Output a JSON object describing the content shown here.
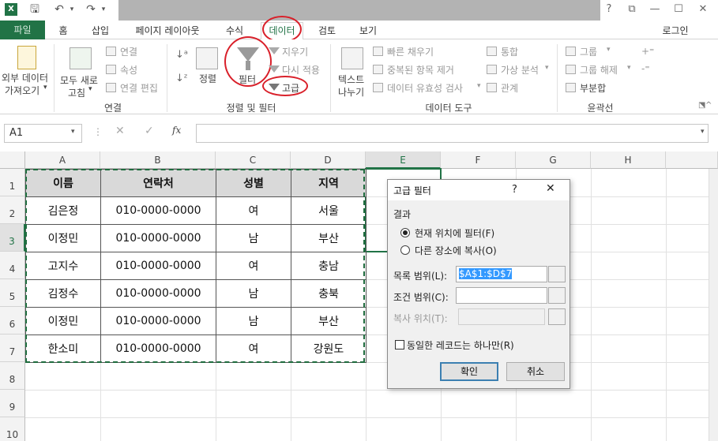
{
  "quick_access": {
    "excel": "X"
  },
  "window_controls": {
    "help": "?",
    "restore_ribbon": "⧉",
    "minimize": "—",
    "maximize": "☐",
    "close": "✕"
  },
  "tabs": [
    "파일",
    "홈",
    "삽입",
    "페이지 레이아웃",
    "수식",
    "데이터",
    "검토",
    "보기"
  ],
  "login": "로그인",
  "ribbon": {
    "external_data": [
      "외부 데이터",
      "가져오기"
    ],
    "refresh_all": [
      "모두 새로",
      "고침"
    ],
    "connections": "연결",
    "properties": "속성",
    "edit_links": "연결 편집",
    "group_connections": "연결",
    "sort": "정렬",
    "filter": "필터",
    "clear": "지우기",
    "reapply": "다시 적용",
    "advanced": "고급",
    "group_sort_filter": "정렬 및 필터",
    "text_to_columns": [
      "텍스트",
      "나누기"
    ],
    "flash_fill": "빠른 채우기",
    "remove_duplicates": "중복된 항목 제거",
    "data_validation": "데이터 유효성 검사",
    "consolidate": "통합",
    "what_if": "가상 분석",
    "relationships": "관계",
    "group_data_tools": "데이터 도구",
    "group": "그룹",
    "ungroup": "그룹 해제",
    "subtotal": "부분합",
    "group_outline": "윤곽선"
  },
  "formula_bar": {
    "name_box": "A1",
    "fx": "fx"
  },
  "columns": [
    "A",
    "B",
    "C",
    "D",
    "E",
    "F",
    "G",
    "H"
  ],
  "rows": [
    "1",
    "2",
    "3",
    "4",
    "5",
    "6",
    "7",
    "8",
    "9",
    "10"
  ],
  "table": {
    "headers": [
      "이름",
      "연락처",
      "성별",
      "지역"
    ],
    "rows": [
      [
        "김은정",
        "010-0000-0000",
        "여",
        "서울"
      ],
      [
        "이정민",
        "010-0000-0000",
        "남",
        "부산"
      ],
      [
        "고지수",
        "010-0000-0000",
        "여",
        "충남"
      ],
      [
        "김정수",
        "010-0000-0000",
        "남",
        "충북"
      ],
      [
        "이정민",
        "010-0000-0000",
        "남",
        "부산"
      ],
      [
        "한소미",
        "010-0000-0000",
        "여",
        "강원도"
      ]
    ]
  },
  "dialog": {
    "title": "고급 필터",
    "help": "?",
    "close": "✕",
    "result_label": "결과",
    "option_inplace": "현재 위치에 필터(F)",
    "option_copy": "다른 장소에 복사(O)",
    "list_range_label": "목록 범위(L):",
    "list_range_value": "$A$1:$D$7",
    "criteria_range_label": "조건 범위(C):",
    "criteria_range_value": "",
    "copy_to_label": "복사 위치(T):",
    "copy_to_value": "",
    "unique_label": "동일한 레코드는 하나만(R)",
    "ok": "확인",
    "cancel": "취소"
  }
}
